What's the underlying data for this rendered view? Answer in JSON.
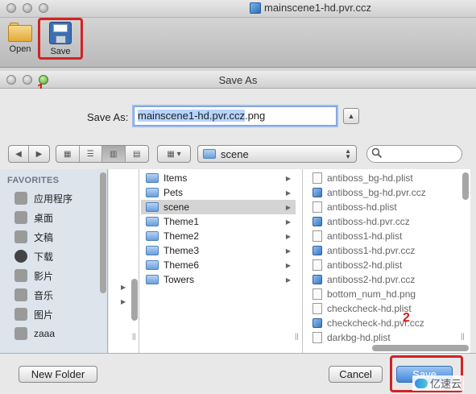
{
  "app": {
    "title": "mainscene1-hd.pvr.ccz",
    "toolbar": {
      "open_label": "Open",
      "save_label": "Save"
    }
  },
  "dialog": {
    "title": "Save As",
    "save_as_label": "Save As:",
    "filename_selected": "mainscene1-hd.pvr.ccz",
    "filename_ext": ".png",
    "location": "scene",
    "search_placeholder": "",
    "annotations": {
      "marker_1": "1",
      "marker_2": "2"
    }
  },
  "sidebar": {
    "heading": "FAVORITES",
    "items": [
      {
        "label": "应用程序",
        "icon": "applications-icon"
      },
      {
        "label": "桌面",
        "icon": "desktop-icon"
      },
      {
        "label": "文稿",
        "icon": "documents-icon"
      },
      {
        "label": "下载",
        "icon": "downloads-icon"
      },
      {
        "label": "影片",
        "icon": "movies-icon"
      },
      {
        "label": "音乐",
        "icon": "music-icon"
      },
      {
        "label": "图片",
        "icon": "pictures-icon"
      },
      {
        "label": "zaaa",
        "icon": "home-icon"
      }
    ]
  },
  "browser": {
    "folders": [
      "Items",
      "Pets",
      "scene",
      "Theme1",
      "Theme2",
      "Theme3",
      "Theme6",
      "Towers"
    ],
    "selected_folder": "scene",
    "files": [
      {
        "name": "antiboss_bg-hd.plist",
        "type": "plist"
      },
      {
        "name": "antiboss_bg-hd.pvr.ccz",
        "type": "ccz"
      },
      {
        "name": "antiboss-hd.plist",
        "type": "plist"
      },
      {
        "name": "antiboss-hd.pvr.ccz",
        "type": "ccz"
      },
      {
        "name": "antiboss1-hd.plist",
        "type": "plist"
      },
      {
        "name": "antiboss1-hd.pvr.ccz",
        "type": "ccz"
      },
      {
        "name": "antiboss2-hd.plist",
        "type": "plist"
      },
      {
        "name": "antiboss2-hd.pvr.ccz",
        "type": "ccz"
      },
      {
        "name": "bottom_num_hd.png",
        "type": "png"
      },
      {
        "name": "checkcheck-hd.plist",
        "type": "plist"
      },
      {
        "name": "checkcheck-hd.pvr.ccz",
        "type": "ccz"
      },
      {
        "name": "darkbg-hd.plist",
        "type": "plist"
      }
    ]
  },
  "buttons": {
    "new_folder": "New Folder",
    "cancel": "Cancel",
    "save": "Save"
  },
  "watermark": "亿速云"
}
